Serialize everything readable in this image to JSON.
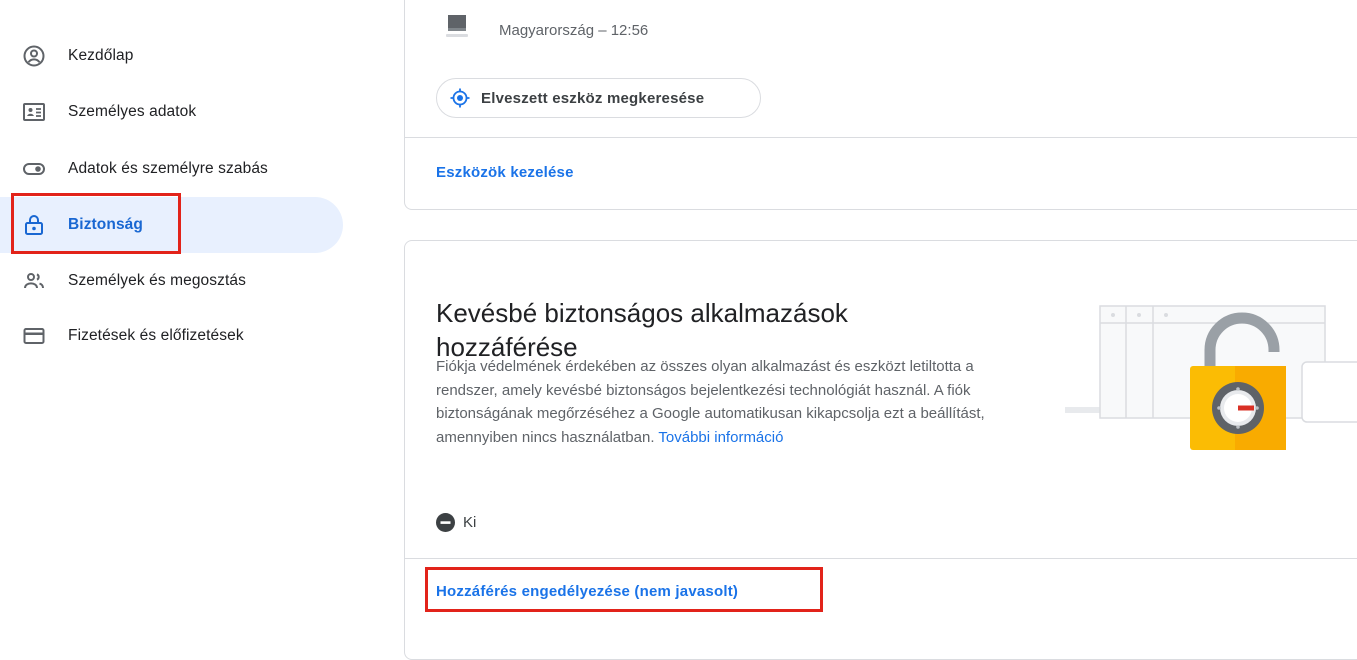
{
  "sidebar": {
    "items": [
      {
        "label": "Kezdőlap",
        "icon": "account-circle-icon"
      },
      {
        "label": "Személyes adatok",
        "icon": "id-card-icon"
      },
      {
        "label": "Adatok és személyre szabás",
        "icon": "toggle-icon"
      },
      {
        "label": "Biztonság",
        "icon": "lock-icon",
        "active": true
      },
      {
        "label": "Személyek és megosztás",
        "icon": "people-icon"
      },
      {
        "label": "Fizetések és előfizetések",
        "icon": "credit-card-icon"
      }
    ]
  },
  "devices": {
    "entry": "Magyarország – 12:56",
    "find_device": "Elveszett eszköz megkeresése",
    "manage": "Eszközök kezelése"
  },
  "less_secure": {
    "title": "Kevésbé biztonságos alkalmazások hozzáférése",
    "description": "Fiókja védelmének érdekében az összes olyan alkalmazást és eszközt letiltotta a rendszer, amely kevésbé biztonságos bejelentkezési technológiát használ. A fiók biztonságának megőrzéséhez a Google automatikusan kikapcsolja ezt a beállítást, amennyiben nincs használatban.",
    "more_info": "További információ",
    "status": "Ki",
    "allow_access": "Hozzáférés engedélyezése (nem javasolt)"
  },
  "colors": {
    "accent": "#1a73e8",
    "active_bg": "#e8f0fe",
    "highlight": "#e2231a",
    "lock_yellow": "#fbbc04"
  }
}
